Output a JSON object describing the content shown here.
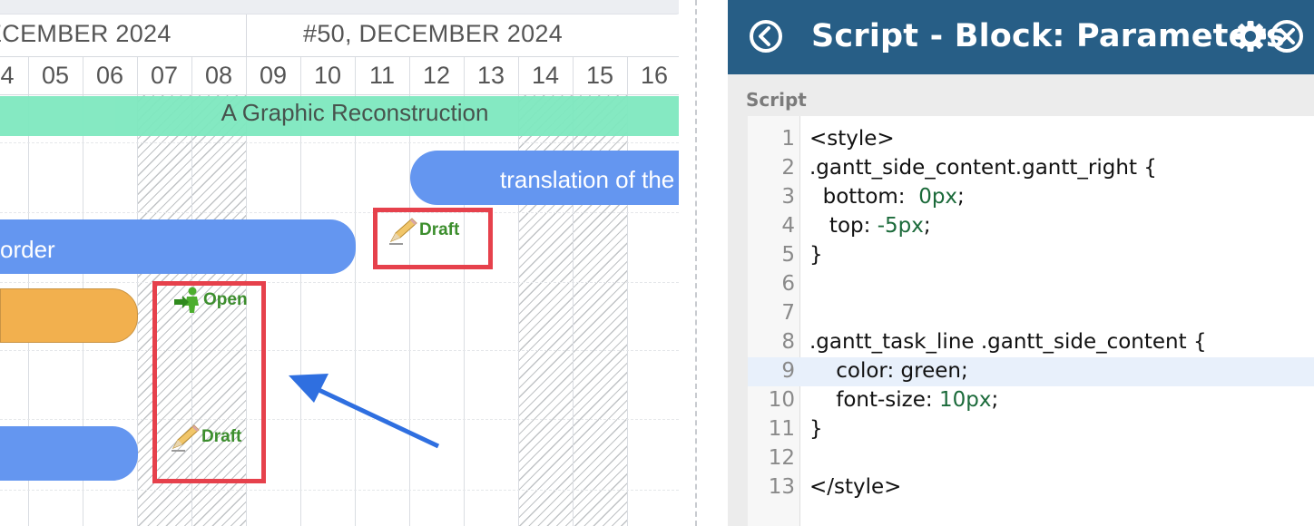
{
  "gantt": {
    "weeks": [
      {
        "label": "ECEMBER 2024"
      },
      {
        "label": "#50, DECEMBER 2024"
      }
    ],
    "days": [
      "4",
      "05",
      "06",
      "07",
      "08",
      "09",
      "10",
      "11",
      "12",
      "13",
      "14",
      "15",
      "16"
    ],
    "project_bar": "A Graphic Reconstruction",
    "tasks": [
      {
        "label": "translation of the"
      },
      {
        "label": "order"
      },
      {
        "label": ""
      },
      {
        "label": ""
      }
    ],
    "side_labels": {
      "draft_top": "Draft",
      "open": "Open",
      "draft_bottom": "Draft"
    },
    "icons": {
      "draft": "pencil-icon",
      "open": "person-arrow-icon"
    }
  },
  "panel": {
    "title": "Script - Block: Parameters",
    "section_label": "Script",
    "header_color": "#275e86",
    "buttons": {
      "back": "back-circle-icon",
      "settings": "gear-icon",
      "close": "close-circle-icon"
    },
    "code_lines": [
      {
        "n": "1",
        "text": "<style>"
      },
      {
        "n": "2",
        "text": ".gantt_side_content.gantt_right {"
      },
      {
        "n": "3",
        "pre": "  bottom:  ",
        "num": "0px",
        "post": ";"
      },
      {
        "n": "4",
        "pre": "   top: ",
        "num": "-5px",
        "post": ";"
      },
      {
        "n": "5",
        "text": "}"
      },
      {
        "n": "6",
        "text": ""
      },
      {
        "n": "7",
        "text": ""
      },
      {
        "n": "8",
        "text": ".gantt_task_line .gantt_side_content {"
      },
      {
        "n": "9",
        "text": "    color: green;"
      },
      {
        "n": "10",
        "pre": "    font-size: ",
        "num": "10px",
        "post": ";"
      },
      {
        "n": "11",
        "text": "}"
      },
      {
        "n": "12",
        "text": ""
      },
      {
        "n": "13",
        "text": "</style>"
      }
    ],
    "active_line": 9
  },
  "colors": {
    "task_blue": "#6496f0",
    "task_orange": "#f2b04e",
    "project_green": "#7ee8bf",
    "highlight_red": "#e6414c",
    "side_text_green": "#3c8e2d",
    "arrow_blue": "#2f6fe0"
  }
}
